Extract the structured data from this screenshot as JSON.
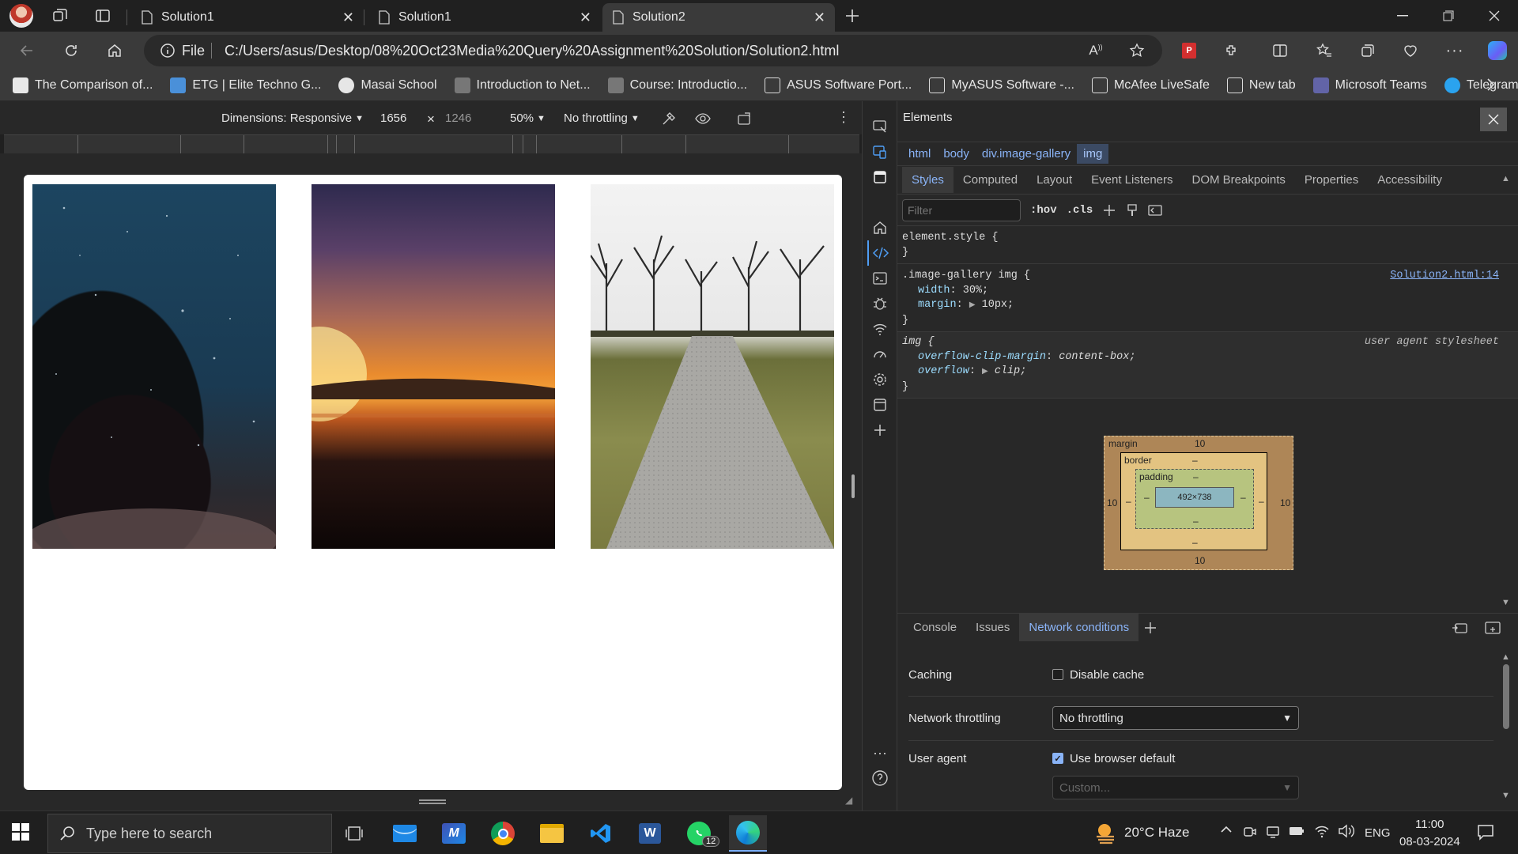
{
  "tabs": [
    {
      "title": "Solution1",
      "active": false
    },
    {
      "title": "Solution1",
      "active": false
    },
    {
      "title": "Solution2",
      "active": true
    }
  ],
  "address": {
    "scheme_label": "File",
    "url": "C:/Users/asus/Desktop/08%20Oct23Media%20Query%20Assignment%20Solution/Solution2.html"
  },
  "bookmarks": [
    {
      "label": "The Comparison of...",
      "color": "#e8e8e8"
    },
    {
      "label": "ETG | Elite Techno G...",
      "color": "#4a90d9"
    },
    {
      "label": "Masai School",
      "color": "#e6e6e6"
    },
    {
      "label": "Introduction to Net...",
      "color": "#888888"
    },
    {
      "label": "Course: Introductio...",
      "color": "#888888"
    },
    {
      "label": "ASUS Software Port...",
      "color": "#dddddd"
    },
    {
      "label": "MyASUS Software -...",
      "color": "#dddddd"
    },
    {
      "label": "McAfee LiveSafe",
      "color": "#dddddd"
    },
    {
      "label": "New tab",
      "color": "#dddddd"
    },
    {
      "label": "Microsoft Teams",
      "color": "#6264a7"
    },
    {
      "label": "Telegram",
      "color": "#2aa3ef"
    }
  ],
  "device_toolbar": {
    "dimensions": "Dimensions: Responsive",
    "width": "1656",
    "times": "×",
    "height": "1246",
    "zoom": "50%",
    "throttling": "No throttling"
  },
  "gallery": {
    "images": [
      "night-sky-person",
      "sunset-sea",
      "gravel-path-trees"
    ]
  },
  "devtools": {
    "title": "Elements",
    "breadcrumbs": [
      "html",
      "body",
      "div.image-gallery",
      "img"
    ],
    "subtabs": [
      "Styles",
      "Computed",
      "Layout",
      "Event Listeners",
      "DOM Breakpoints",
      "Properties",
      "Accessibility"
    ],
    "filter_placeholder": "Filter",
    "hov": ":hov",
    "cls": ".cls",
    "rules": {
      "element_style": {
        "selector": "element.style {",
        "close": "}"
      },
      "gallery": {
        "selector": ".image-gallery img {",
        "source": "Solution2.html:14",
        "p1_name": "width",
        "p1_value": "30%;",
        "p2_name": "margin",
        "p2_value": "10px;",
        "close": "}"
      },
      "ua": {
        "selector": "img {",
        "source": "user agent stylesheet",
        "p1_name": "overflow-clip-margin",
        "p1_value": "content-box;",
        "p2_name": "overflow",
        "p2_value": "clip;",
        "close": "}"
      }
    },
    "box_model": {
      "margin_label": "margin",
      "border_label": "border",
      "padding_label": "padding",
      "margin_top": "10",
      "margin_bottom": "10",
      "margin_left": "10",
      "margin_right": "10",
      "border_top": "–",
      "border_bottom": "–",
      "border_left": "–",
      "border_right": "–",
      "padding_top": "–",
      "padding_bottom": "–",
      "padding_left": "–",
      "padding_right": "–",
      "content": "492×738"
    },
    "drawer_tabs": [
      "Console",
      "Issues",
      "Network conditions"
    ],
    "network_conditions": {
      "caching_label": "Caching",
      "disable_cache": "Disable cache",
      "throttling_label": "Network throttling",
      "throttling_value": "No throttling",
      "ua_label": "User agent",
      "use_default": "Use browser default",
      "custom_placeholder": "Custom..."
    }
  },
  "taskbar": {
    "search_placeholder": "Type here to search",
    "weather": "20°C  Haze",
    "lang": "ENG",
    "time": "11:00",
    "date": "08-03-2024",
    "whatsapp_badge": "12"
  }
}
